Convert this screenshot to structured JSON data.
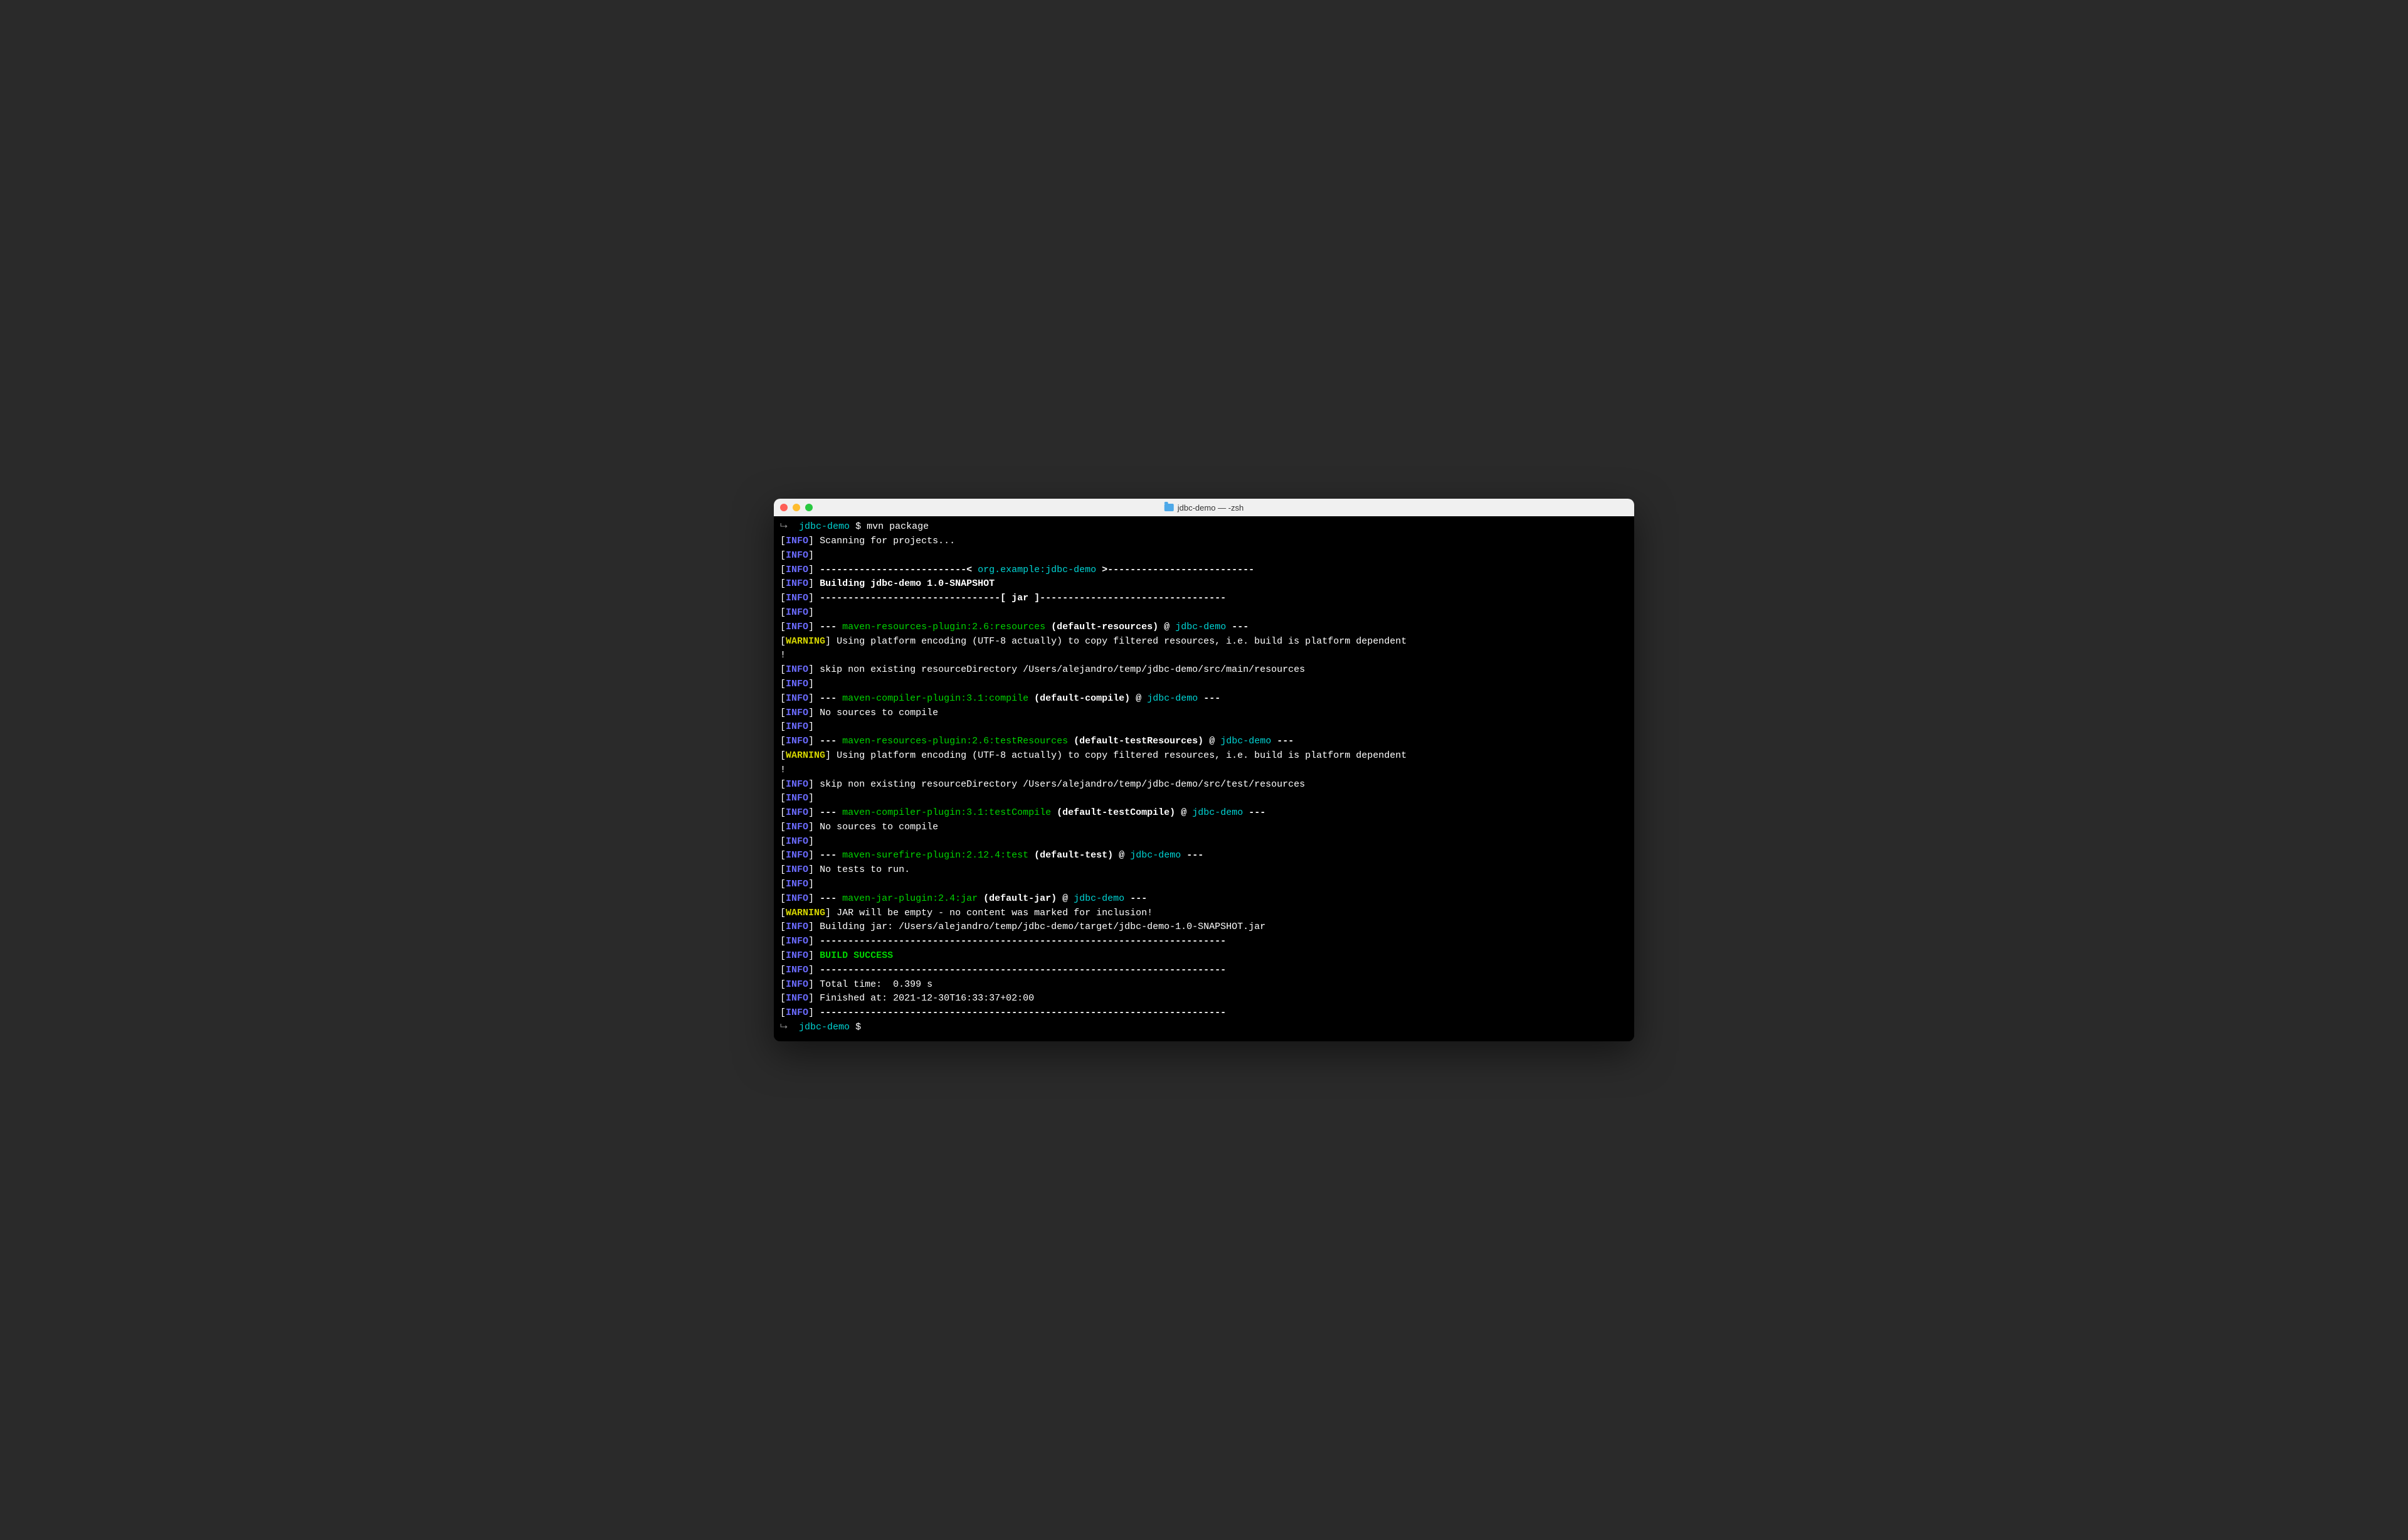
{
  "window": {
    "title": "jdbc-demo — -zsh"
  },
  "prompt": {
    "dir": "jdbc-demo",
    "symbol": "$",
    "command": "mvn package"
  },
  "lines": {
    "l1": "Scanning for projects...",
    "l2": "--------------------------< ",
    "l2b": "org.example:jdbc-demo",
    "l2c": " >--------------------------",
    "l3": "Building jdbc-demo 1.0-SNAPSHOT",
    "l4": "--------------------------------[ jar ]---------------------------------",
    "l5a": "--- ",
    "l5b": "maven-resources-plugin:2.6:resources",
    "l5c": " (default-resources)",
    "l5d": " @ ",
    "l5e": "jdbc-demo",
    "l5f": " ---",
    "l6": "Using platform encoding (UTF-8 actually) to copy filtered resources, i.e. build is platform dependent",
    "l6b": "!",
    "l7": "skip non existing resourceDirectory /Users/alejandro/temp/jdbc-demo/src/main/resources",
    "l8a": "--- ",
    "l8b": "maven-compiler-plugin:3.1:compile",
    "l8c": " (default-compile)",
    "l8d": " @ ",
    "l8e": "jdbc-demo",
    "l8f": " ---",
    "l9": "No sources to compile",
    "l10a": "--- ",
    "l10b": "maven-resources-plugin:2.6:testResources",
    "l10c": " (default-testResources)",
    "l10d": " @ ",
    "l10e": "jdbc-demo",
    "l10f": " ---",
    "l11": "Using platform encoding (UTF-8 actually) to copy filtered resources, i.e. build is platform dependent",
    "l11b": "!",
    "l12": "skip non existing resourceDirectory /Users/alejandro/temp/jdbc-demo/src/test/resources",
    "l13a": "--- ",
    "l13b": "maven-compiler-plugin:3.1:testCompile",
    "l13c": " (default-testCompile)",
    "l13d": " @ ",
    "l13e": "jdbc-demo",
    "l13f": " ---",
    "l14": "No sources to compile",
    "l15a": "--- ",
    "l15b": "maven-surefire-plugin:2.12.4:test",
    "l15c": " (default-test)",
    "l15d": " @ ",
    "l15e": "jdbc-demo",
    "l15f": " ---",
    "l16": "No tests to run.",
    "l17a": "--- ",
    "l17b": "maven-jar-plugin:2.4:jar",
    "l17c": " (default-jar)",
    "l17d": " @ ",
    "l17e": "jdbc-demo",
    "l17f": " ---",
    "l18": "JAR will be empty - no content was marked for inclusion!",
    "l19": "Building jar: /Users/alejandro/temp/jdbc-demo/target/jdbc-demo-1.0-SNAPSHOT.jar",
    "l20": "------------------------------------------------------------------------",
    "l21": "BUILD SUCCESS",
    "l22": "------------------------------------------------------------------------",
    "l23": "Total time:  0.399 s",
    "l24": "Finished at: 2021-12-30T16:33:37+02:00",
    "l25": "------------------------------------------------------------------------"
  },
  "tags": {
    "info": "INFO",
    "warning": "WARNING"
  }
}
